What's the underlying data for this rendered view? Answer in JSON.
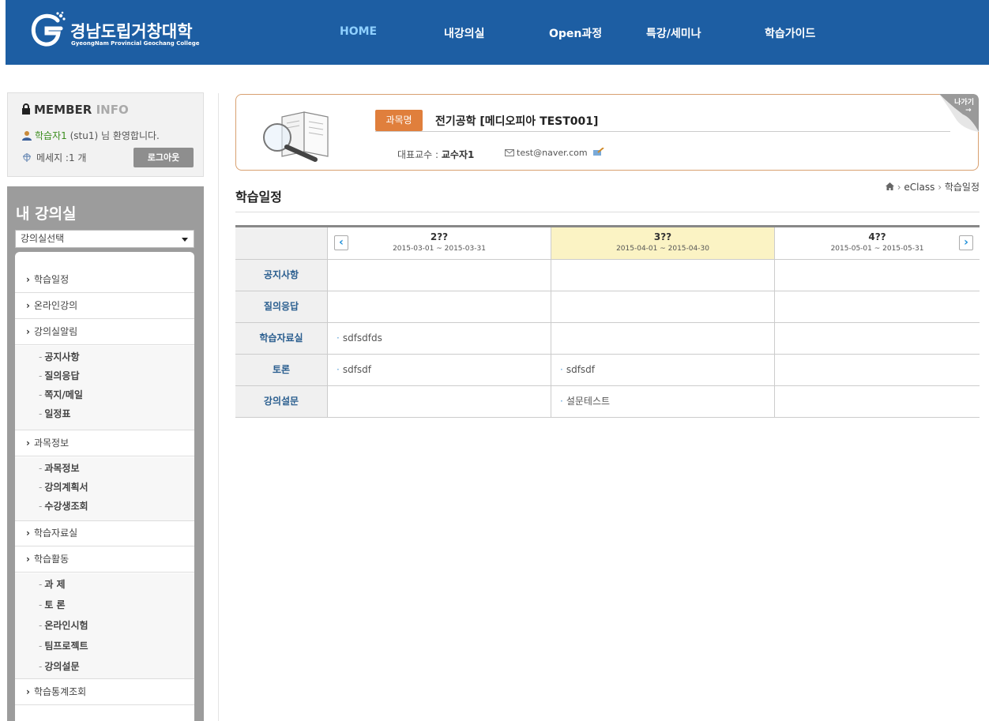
{
  "header": {
    "logo_title": "경남도립거창대학",
    "logo_subtitle": "GyeongNam Provincial Geochang College",
    "nav": [
      "HOME",
      "내강의실",
      "Open과정",
      "특강/세미나",
      "학습가이드"
    ],
    "nav_active": "HOME"
  },
  "member": {
    "title_bold": "MEMBER",
    "title_light": "INFO",
    "user_name": "학습자1",
    "welcome_suffix": "(stu1) 님 환영합니다.",
    "message": "메세지 :1 개",
    "logout_label": "로그아웃"
  },
  "sidebar": {
    "title": "내 강의실",
    "select_value": "강의실선택",
    "menu": [
      {
        "label": "학습일정",
        "subs": []
      },
      {
        "label": "온라인강의",
        "subs": []
      },
      {
        "label": "강의실알림",
        "subs": [
          "공지사항",
          "질의응답",
          "쪽지/메일",
          "일정표"
        ]
      },
      {
        "label": "과목정보",
        "subs": [
          "과목정보",
          "강의계획서",
          "수강생조회"
        ]
      },
      {
        "label": "학습자료실",
        "subs": []
      },
      {
        "label": "학습활동",
        "subs": [
          "과 제",
          "토 론",
          "온라인시험",
          "팀프로젝트",
          "강의설문"
        ]
      },
      {
        "label": "학습통계조회",
        "subs": []
      }
    ]
  },
  "course": {
    "label": "과목명",
    "name": "전기공학 [메디오피아 TEST001]",
    "prof_prefix": "대표교수 :",
    "prof_name": "교수자1",
    "email": "test@naver.com",
    "exit_label": "나가기"
  },
  "page": {
    "title": "학습일정",
    "breadcrumb": [
      "eClass",
      "학습일정"
    ]
  },
  "schedule": {
    "months": [
      {
        "label": "2??",
        "range": "2015-03-01 ~ 2015-03-31",
        "highlight": false
      },
      {
        "label": "3??",
        "range": "2015-04-01 ~ 2015-04-30",
        "highlight": true
      },
      {
        "label": "4??",
        "range": "2015-05-01 ~ 2015-05-31",
        "highlight": false
      }
    ],
    "rows": [
      {
        "label": "공지사항",
        "cells": [
          "",
          "",
          ""
        ]
      },
      {
        "label": "질의응답",
        "cells": [
          "",
          "",
          ""
        ]
      },
      {
        "label": "학습자료실",
        "cells": [
          "sdfsdfds",
          "",
          ""
        ]
      },
      {
        "label": "토론",
        "cells": [
          "sdfsdf",
          "sdfsdf",
          ""
        ]
      },
      {
        "label": "강의설문",
        "cells": [
          "",
          "설문테스트",
          ""
        ]
      }
    ],
    "highlight_color": "#fbf3c4"
  }
}
